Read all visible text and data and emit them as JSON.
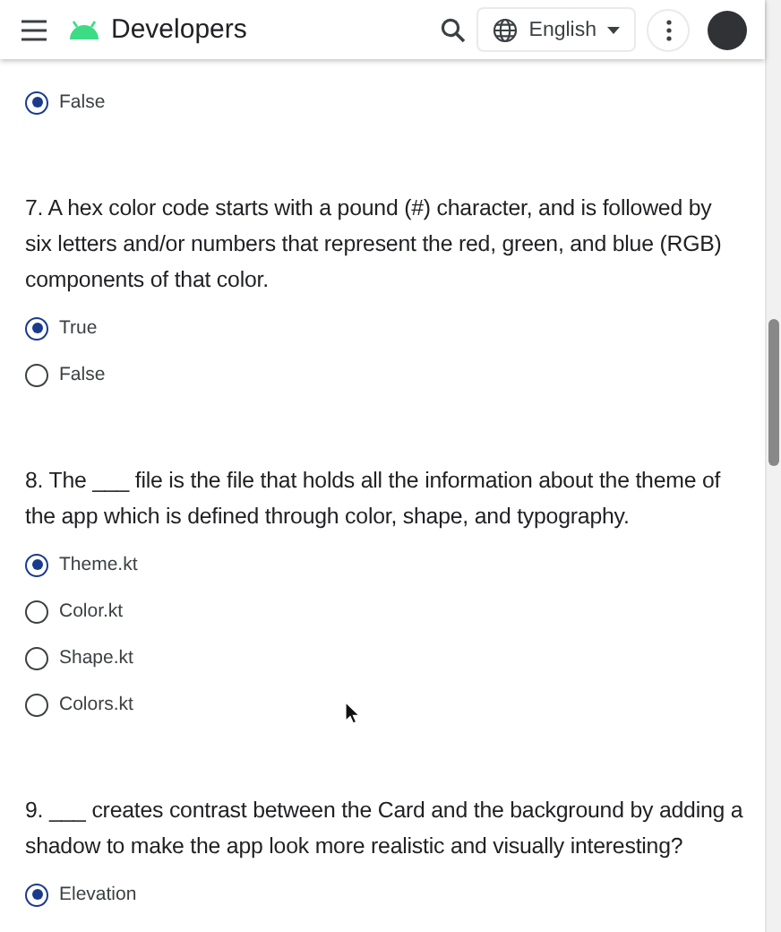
{
  "header": {
    "brand": "Developers",
    "language": "English"
  },
  "questions": [
    {
      "options": [
        {
          "label": "False",
          "selected": true
        }
      ]
    },
    {
      "prompt": "7. A hex color code starts with a pound (#) character, and is followed by six letters and/or numbers that represent the red, green, and blue (RGB) components of that color.",
      "options": [
        {
          "label": "True",
          "selected": true
        },
        {
          "label": "False",
          "selected": false
        }
      ]
    },
    {
      "prompt": "8. The ___ file is the file that holds all the information about the theme of the app which is defined through color, shape, and typography.",
      "options": [
        {
          "label": "Theme.kt",
          "selected": true
        },
        {
          "label": "Color.kt",
          "selected": false
        },
        {
          "label": "Shape.kt",
          "selected": false
        },
        {
          "label": "Colors.kt",
          "selected": false
        }
      ]
    },
    {
      "prompt": "9. ___ creates contrast between the Card and the background by adding a shadow to make the app look more realistic and visually interesting?",
      "options": [
        {
          "label": "Elevation",
          "selected": true
        }
      ]
    }
  ]
}
